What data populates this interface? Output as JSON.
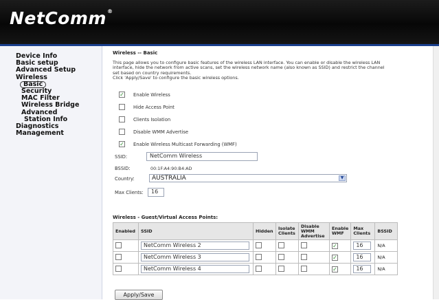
{
  "brand": {
    "logo_text": "NetComm",
    "logo_mark": "®"
  },
  "sidebar": {
    "items": [
      {
        "label": "Device Info",
        "level": 0
      },
      {
        "label": "Basic setup",
        "level": 0
      },
      {
        "label": "Advanced Setup",
        "level": 0
      },
      {
        "label": "Wireless",
        "level": 0
      },
      {
        "label": "Basic",
        "level": 1,
        "active": true
      },
      {
        "label": "Security",
        "level": 1
      },
      {
        "label": "MAC Filter",
        "level": 1
      },
      {
        "label": "Wireless Bridge",
        "level": 1
      },
      {
        "label": "Advanced",
        "level": 1
      },
      {
        "label": "Station Info",
        "level": 2
      },
      {
        "label": "Diagnostics",
        "level": 0
      },
      {
        "label": "Management",
        "level": 0
      }
    ]
  },
  "main": {
    "title": "Wireless -- Basic",
    "description_1": "This page allows you to configure basic features of the wireless LAN interface. You can enable or disable the wireless LAN",
    "description_2": "interface, hide the network from active scans, set the wireless network name (also known as SSID) and restrict the channel",
    "description_3": "set based on country requirements.",
    "description_4": "Click 'Apply/Save' to configure the basic wireless options.",
    "options": [
      {
        "label": "Enable Wireless",
        "checked": true
      },
      {
        "label": "Hide Access Point",
        "checked": false
      },
      {
        "label": "Clients Isolation",
        "checked": false
      },
      {
        "label": "Disable WMM Advertise",
        "checked": false
      },
      {
        "label": "Enable Wireless Multicast Forwarding (WMF)",
        "checked": true
      }
    ],
    "ssid_label": "SSID:",
    "ssid_value": "NetComm Wireless",
    "bssid_label": "BSSID:",
    "bssid_value": "00:1F:A4:90:B4:AD",
    "country_label": "Country:",
    "country_value": "AUSTRALIA",
    "max_clients_label": "Max Clients:",
    "max_clients_value": "16",
    "guest_title": "Wireless - Guest/Virtual Access Points:",
    "guest_headers": [
      "Enabled",
      "SSID",
      "Hidden",
      "Isolate Clients",
      "Disable WMM Advertise",
      "Enable WMF",
      "Max Clients",
      "BSSID"
    ],
    "guest_rows": [
      {
        "enabled": false,
        "ssid": "NetComm Wireless 2",
        "hidden": false,
        "isolate": false,
        "disable_wmm": false,
        "wmf": true,
        "max_clients": "16",
        "bssid": "N/A"
      },
      {
        "enabled": false,
        "ssid": "NetComm Wireless 3",
        "hidden": false,
        "isolate": false,
        "disable_wmm": false,
        "wmf": true,
        "max_clients": "16",
        "bssid": "N/A"
      },
      {
        "enabled": false,
        "ssid": "NetComm Wireless 4",
        "hidden": false,
        "isolate": false,
        "disable_wmm": false,
        "wmf": true,
        "max_clients": "16",
        "bssid": "N/A"
      }
    ],
    "apply_label": "Apply/Save"
  },
  "icons": {
    "checkbox_checked": "check-icon",
    "dropdown": "chevron-down-icon"
  },
  "colors": {
    "header_bg": "#0b0b0b",
    "accent_bar": "#1a3f8c",
    "sidebar_bg": "#f3f4f9",
    "check": "#2a8a2a"
  }
}
